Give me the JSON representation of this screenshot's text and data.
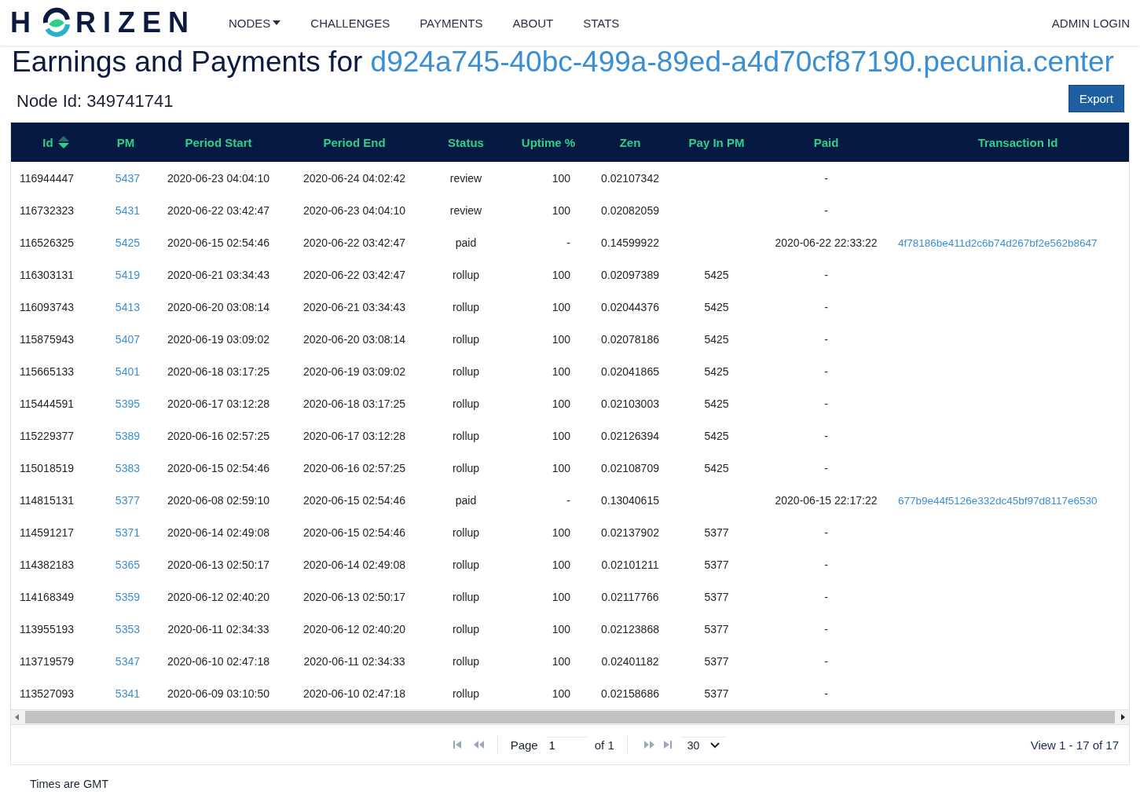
{
  "logo": {
    "left": "H",
    "right": "RIZEN"
  },
  "nav": [
    {
      "label": "NODES",
      "dropdown": true
    },
    {
      "label": "CHALLENGES",
      "dropdown": false
    },
    {
      "label": "PAYMENTS",
      "dropdown": false
    },
    {
      "label": "ABOUT",
      "dropdown": false
    },
    {
      "label": "STATS",
      "dropdown": false
    }
  ],
  "admin_login": "ADMIN LOGIN",
  "title": {
    "prefix": "Earnings and Payments for ",
    "host": "d924a745-40bc-499a-89ed-a4d70cf87190.pecunia.center"
  },
  "node_id": "Node Id: 349741741",
  "export_button": "Export",
  "table": {
    "columns": [
      {
        "label": "Id",
        "sorted": true
      },
      {
        "label": "PM",
        "sorted": false
      },
      {
        "label": "Period Start",
        "sorted": false
      },
      {
        "label": "Period End",
        "sorted": false
      },
      {
        "label": "Status",
        "sorted": false
      },
      {
        "label": "Uptime %",
        "sorted": false
      },
      {
        "label": "Zen",
        "sorted": false
      },
      {
        "label": "Pay In PM",
        "sorted": false
      },
      {
        "label": "Paid",
        "sorted": false
      },
      {
        "label": "Transaction Id",
        "sorted": false
      }
    ],
    "rows": [
      [
        "116944447",
        "5437",
        "2020-06-23 04:04:10",
        "2020-06-24 04:02:42",
        "review",
        "100",
        "0.02107342",
        "",
        "-",
        ""
      ],
      [
        "116732323",
        "5431",
        "2020-06-22 03:42:47",
        "2020-06-23 04:04:10",
        "review",
        "100",
        "0.02082059",
        "",
        "-",
        ""
      ],
      [
        "116526325",
        "5425",
        "2020-06-15 02:54:46",
        "2020-06-22 03:42:47",
        "paid",
        "-",
        "0.14599922",
        "",
        "2020-06-22 22:33:22",
        "4f78186be411d2c6b74d267bf2e562b8647"
      ],
      [
        "116303131",
        "5419",
        "2020-06-21 03:34:43",
        "2020-06-22 03:42:47",
        "rollup",
        "100",
        "0.02097389",
        "5425",
        "-",
        ""
      ],
      [
        "116093743",
        "5413",
        "2020-06-20 03:08:14",
        "2020-06-21 03:34:43",
        "rollup",
        "100",
        "0.02044376",
        "5425",
        "-",
        ""
      ],
      [
        "115875943",
        "5407",
        "2020-06-19 03:09:02",
        "2020-06-20 03:08:14",
        "rollup",
        "100",
        "0.02078186",
        "5425",
        "-",
        ""
      ],
      [
        "115665133",
        "5401",
        "2020-06-18 03:17:25",
        "2020-06-19 03:09:02",
        "rollup",
        "100",
        "0.02041865",
        "5425",
        "-",
        ""
      ],
      [
        "115444591",
        "5395",
        "2020-06-17 03:12:28",
        "2020-06-18 03:17:25",
        "rollup",
        "100",
        "0.02103003",
        "5425",
        "-",
        ""
      ],
      [
        "115229377",
        "5389",
        "2020-06-16 02:57:25",
        "2020-06-17 03:12:28",
        "rollup",
        "100",
        "0.02126394",
        "5425",
        "-",
        ""
      ],
      [
        "115018519",
        "5383",
        "2020-06-15 02:54:46",
        "2020-06-16 02:57:25",
        "rollup",
        "100",
        "0.02108709",
        "5425",
        "-",
        ""
      ],
      [
        "114815131",
        "5377",
        "2020-06-08 02:59:10",
        "2020-06-15 02:54:46",
        "paid",
        "-",
        "0.13040615",
        "",
        "2020-06-15 22:17:22",
        "677b9e44f5126e332dc45bf97d8117e6530"
      ],
      [
        "114591217",
        "5371",
        "2020-06-14 02:49:08",
        "2020-06-15 02:54:46",
        "rollup",
        "100",
        "0.02137902",
        "5377",
        "-",
        ""
      ],
      [
        "114382183",
        "5365",
        "2020-06-13 02:50:17",
        "2020-06-14 02:49:08",
        "rollup",
        "100",
        "0.02101211",
        "5377",
        "-",
        ""
      ],
      [
        "114168349",
        "5359",
        "2020-06-12 02:40:20",
        "2020-06-13 02:50:17",
        "rollup",
        "100",
        "0.02117766",
        "5377",
        "-",
        ""
      ],
      [
        "113955193",
        "5353",
        "2020-06-11 02:34:33",
        "2020-06-12 02:40:20",
        "rollup",
        "100",
        "0.02123868",
        "5377",
        "-",
        ""
      ],
      [
        "113719579",
        "5347",
        "2020-06-10 02:47:18",
        "2020-06-11 02:34:33",
        "rollup",
        "100",
        "0.02401182",
        "5377",
        "-",
        ""
      ],
      [
        "113527093",
        "5341",
        "2020-06-09 03:10:50",
        "2020-06-10 02:47:18",
        "rollup",
        "100",
        "0.02158686",
        "5377",
        "-",
        ""
      ]
    ]
  },
  "pager": {
    "page_label": "Page",
    "page_value": "1",
    "of_label": "of 1",
    "page_size": "30",
    "view": "View 1 - 17 of 17"
  },
  "footer": "Times are GMT"
}
